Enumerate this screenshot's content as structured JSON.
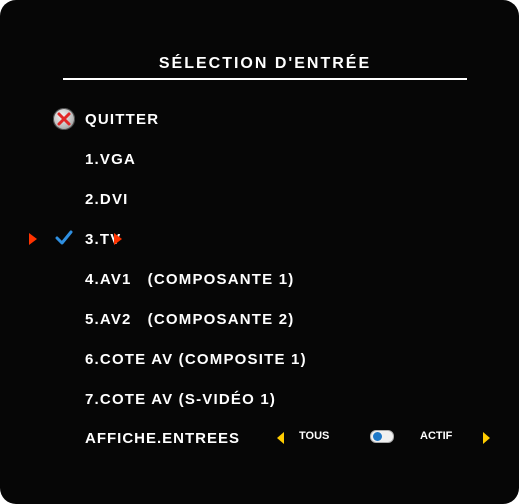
{
  "menu": {
    "title": "SÉLECTION D'ENTRÉE",
    "quit_label": "QUITTER",
    "items": [
      "1.VGA",
      "2.DVI",
      "3.TV",
      "4.AV1   (COMPOSANTE 1)",
      "5.AV2   (COMPOSANTE 2)",
      "6.COTE AV (COMPOSITE 1)",
      "7.COTE AV (S-VIDÉO 1)"
    ]
  },
  "bottom_bar": {
    "display_label": "AFFICHE.ENTREES",
    "all_label": "TOUS",
    "active_label": "ACTIF"
  },
  "colors": {
    "background": "#060606",
    "text": "#ffffff",
    "selection_arrow": "#ff3300",
    "navigation_arrow": "#ffcc00",
    "check": "#2f8fe0"
  },
  "selected_item": "3.TV",
  "icons": [
    "quit-icon",
    "selection-arrow-icon",
    "check-icon",
    "navigation-arrow-icon",
    "toggle-icon"
  ]
}
